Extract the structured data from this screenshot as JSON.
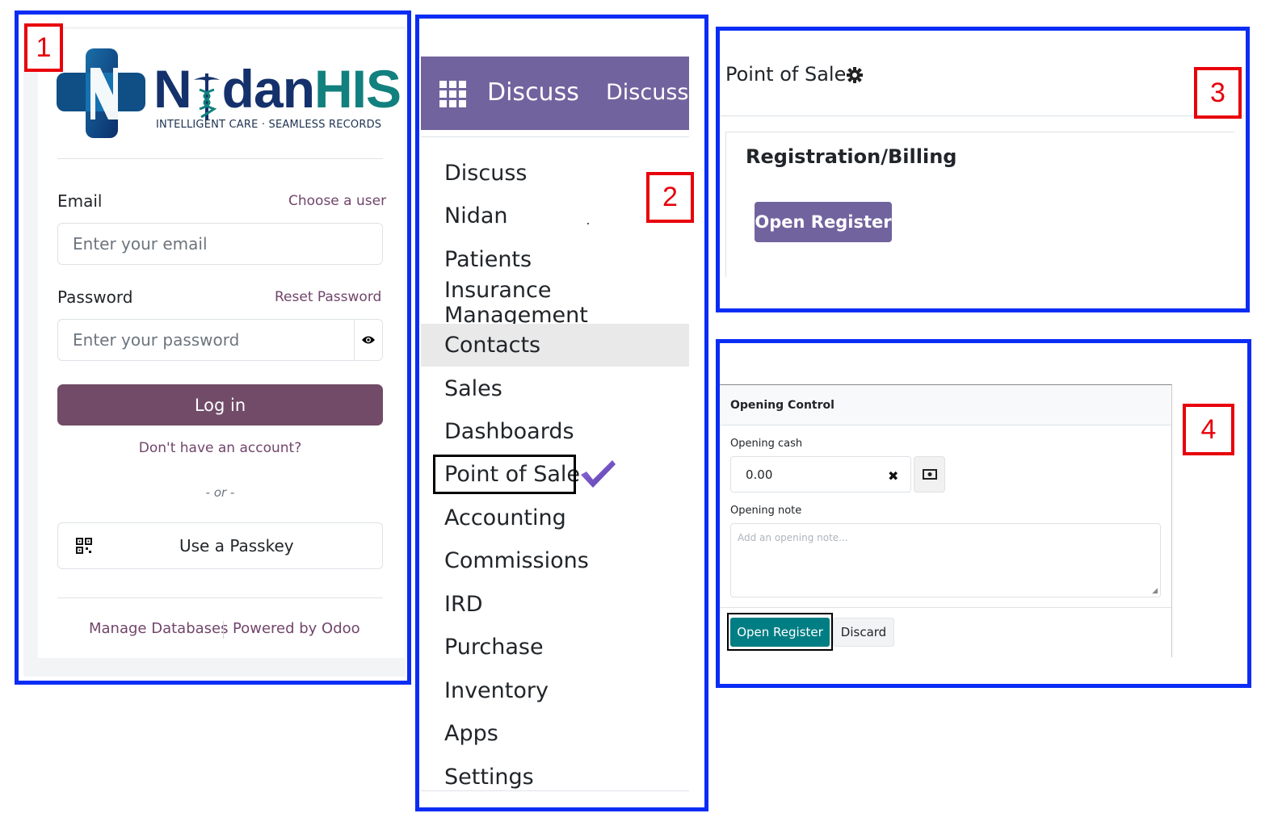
{
  "login": {
    "brand": {
      "name_prefix": "N",
      "name_middle": "dan",
      "name_suffix": "HIS",
      "tagline": "INTELLIGENT CARE · SEAMLESS RECORDS"
    },
    "email_label": "Email",
    "choose_user": "Choose a user",
    "email_placeholder": "Enter your email",
    "password_label": "Password",
    "reset_password": "Reset Password",
    "password_placeholder": "Enter your password",
    "login_button": "Log in",
    "signup": "Don't have an account?",
    "or": "- or -",
    "passkey_button": "Use a Passkey",
    "manage_databases": "Manage Databases",
    "powered_by": "Powered by Odoo"
  },
  "menu": {
    "navbar_title": "Discuss",
    "navbar_item": "Discuss",
    "items": [
      "Discuss",
      "Nidan",
      "Patients",
      "Insurance Management",
      "Contacts",
      "Sales",
      "Dashboards",
      "Point of Sale",
      "Accounting",
      "Commissions",
      "IRD",
      "Purchase",
      "Inventory",
      "Apps",
      "Settings"
    ],
    "active_item": "Contacts",
    "highlighted_item": "Point of Sale"
  },
  "pos": {
    "title": "Point of Sale",
    "card_title": "Registration/Billing",
    "open_register": "Open Register"
  },
  "opening_control": {
    "title": "Opening Control",
    "cash_label": "Opening cash",
    "cash_value": "0.00",
    "note_label": "Opening note",
    "note_placeholder": "Add an opening note...",
    "open_register": "Open Register",
    "discard": "Discard"
  },
  "annotations": {
    "step1": "1",
    "step2": "2",
    "step3": "3",
    "step4": "4"
  },
  "colors": {
    "brand_purple": "#714b67",
    "navbar": "#71639e",
    "primary": "#71639e",
    "teal": "#017e84",
    "annotation_blue": "#0a2cf5",
    "annotation_red": "#e8000b"
  }
}
